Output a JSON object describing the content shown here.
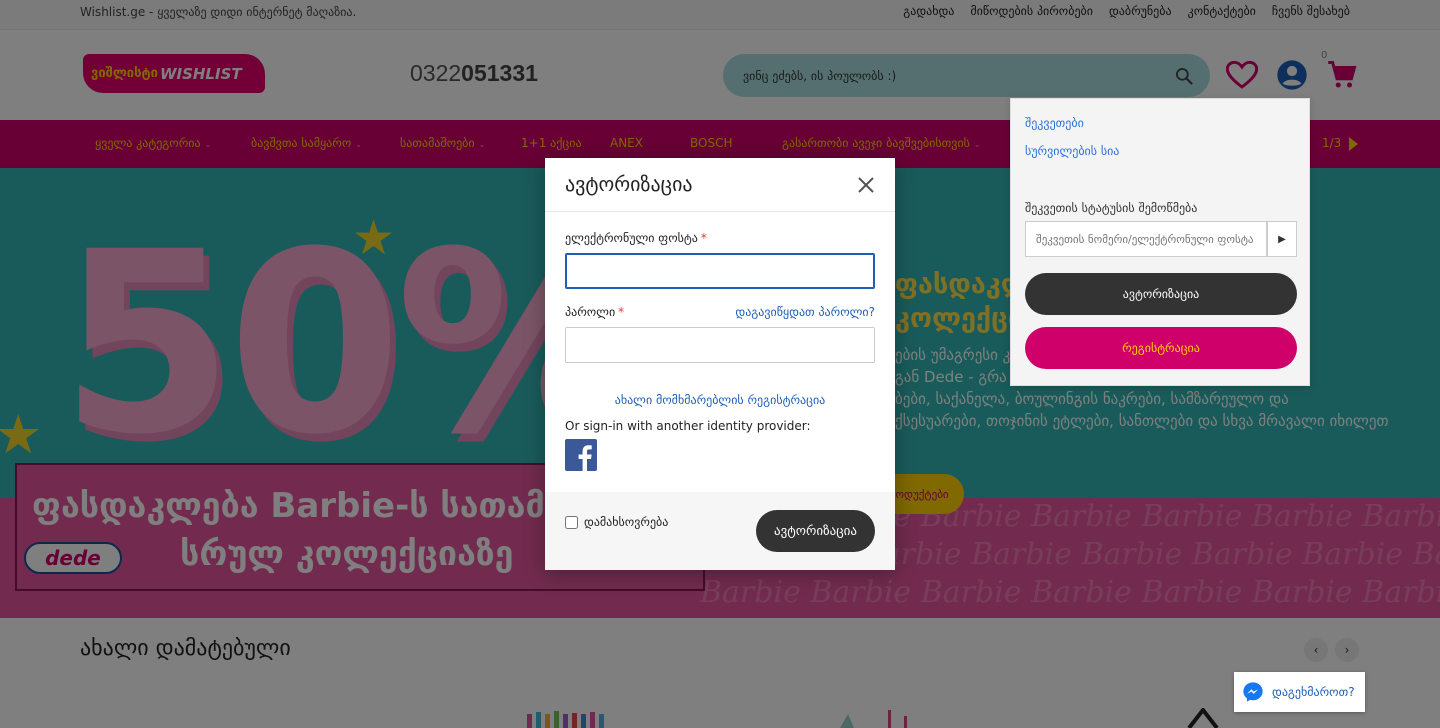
{
  "topbar": {
    "tagline": "Wishlist.ge - ყველაზე დიდი ინტერნეტ მაღაზია.",
    "links": [
      "გადახდა",
      "მიწოდების პირობები",
      "დაბრუნება",
      "კონტაქტები",
      "ჩვენს შესახებ"
    ]
  },
  "header": {
    "logo_ge": "ვიშლისტი",
    "logo_en": "WISHLIST",
    "phone_prefix": "0322",
    "phone_main": "051331",
    "search_placeholder": "ვინც ეძებს, ის პოულობს :)",
    "cart_count": "0"
  },
  "nav": {
    "items": [
      {
        "label": "ყველა კატეგორია",
        "chev": true
      },
      {
        "label": "ბავშვთა სამყარო",
        "chev": true
      },
      {
        "label": "სათამაშოები",
        "chev": true
      },
      {
        "label": "1+1 აქცია",
        "chev": false
      },
      {
        "label": "ANEX",
        "chev": false
      },
      {
        "label": "BOSCH",
        "chev": false
      },
      {
        "label": "გასართობი ავეჯი ბავშვებისთვის",
        "chev": true
      }
    ],
    "pager": "1/3"
  },
  "banner": {
    "big_number": "50%",
    "right_title_line1": "ფასდაკლ                    ების",
    "right_title_line2": "კოლექციაზ",
    "right_text": "ების უმაგრესი კ                                          რქეთის\n    გან Dede - გრა                                    ოლიაჟები,\n    ბები, საქანელა, ბოულინგის ნაკრები, სამზარეულო და\n    ქსესუარები, თოჯინის ეტლები, სანთლები და სხვა მრავალი იხილეთ",
    "button": "ოდუქტები",
    "promo_line1": "ფასდაკლება Barbie-ს სათამ",
    "promo_line2": "სრულ კოლექციაზე",
    "brand": "dede",
    "pattern": "Barbie Barbie Barbie Barbie Barbie Barbie Barbie Barbie Barbie Barbie Barbie Barbie Barbie Barbie Barbie Barbie Barbie Barbie Barbie"
  },
  "section": {
    "title": "ახალი დამატებული"
  },
  "dropdown": {
    "orders": "შეკვეთები",
    "wishlist": "სურვილების სია",
    "status_label": "შეკვეთის სტატუსის შემოწმება",
    "status_placeholder": "შეკვეთის ნომერი/ელექტრონული ფოსტა",
    "login": "ავტორიზაცია",
    "register": "რეგისტრაცია"
  },
  "modal": {
    "title": "ავტორიზაცია",
    "email_label": "ელექტრონული ფოსტა",
    "password_label": "პაროლი",
    "required_mark": "*",
    "forgot": "დაგავიწყდათ პაროლი?",
    "register": "ახალი მომხმარებლის რეგისტრაცია",
    "or_sign": "Or sign-in with another identity provider:",
    "remember": "დამახსოვრება",
    "login_button": "ავტორიზაცია"
  },
  "messenger": {
    "label": "დაგეხმაროთ?"
  },
  "colors": {
    "brand_pink": "#d0006b",
    "brand_yellow": "#ffd200",
    "search_bg": "#abdfe0",
    "link_blue": "#1d5eb8",
    "dark_button": "#333333"
  }
}
